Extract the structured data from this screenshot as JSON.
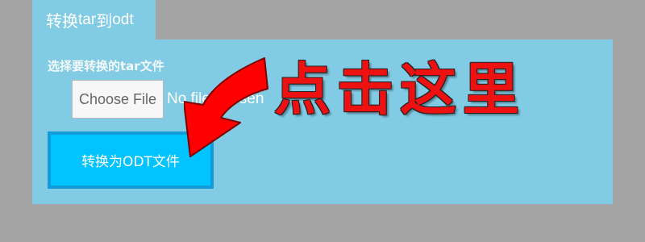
{
  "tab": {
    "title_cjk_1": "转换",
    "title_latin_1": "tar",
    "title_cjk_2": "到",
    "title_latin_2": "odt"
  },
  "form": {
    "label": "选择要转换的tar文件",
    "choose_file_label": "Choose File",
    "file_status": "No file chosen",
    "convert_button_label": "转换为ODT文件"
  },
  "annotation": {
    "callout_text": "点击这里",
    "callout_color": "#ee1111",
    "arrow_color": "#ff0000"
  },
  "colors": {
    "background": "#a4a4a4",
    "panel": "#82cbe4",
    "button": "#00c3ff",
    "button_border": "#139ad9"
  }
}
